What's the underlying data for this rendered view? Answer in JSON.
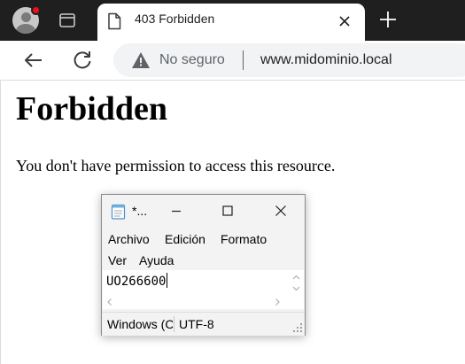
{
  "browser": {
    "active_tab": {
      "title": "403 Forbidden"
    },
    "omnibox": {
      "security_label": "No seguro",
      "url": "www.midominio.local"
    }
  },
  "page": {
    "heading": "Forbidden",
    "message": "You don't have permission to access this resource."
  },
  "notepad": {
    "title": "*...",
    "menu": [
      "Archivo",
      "Edición",
      "Formato",
      "Ver",
      "Ayuda"
    ],
    "content": "UO266600",
    "status": {
      "line_ending": "Windows (CRLF)",
      "encoding": "UTF-8"
    }
  },
  "colors": {
    "tabstrip_bg": "#1f1f1f",
    "omnibox_bg": "#f1f3f4",
    "notification_dot": "#e81123"
  },
  "icons": {
    "profile": "profile-avatar-icon",
    "tab_search": "tab-search-icon",
    "tab_page": "page-icon",
    "tab_close": "close-icon",
    "new_tab": "plus-icon",
    "back": "arrow-left-icon",
    "reload": "reload-icon",
    "security": "warning-triangle-icon",
    "notepad_app": "notepad-icon"
  }
}
